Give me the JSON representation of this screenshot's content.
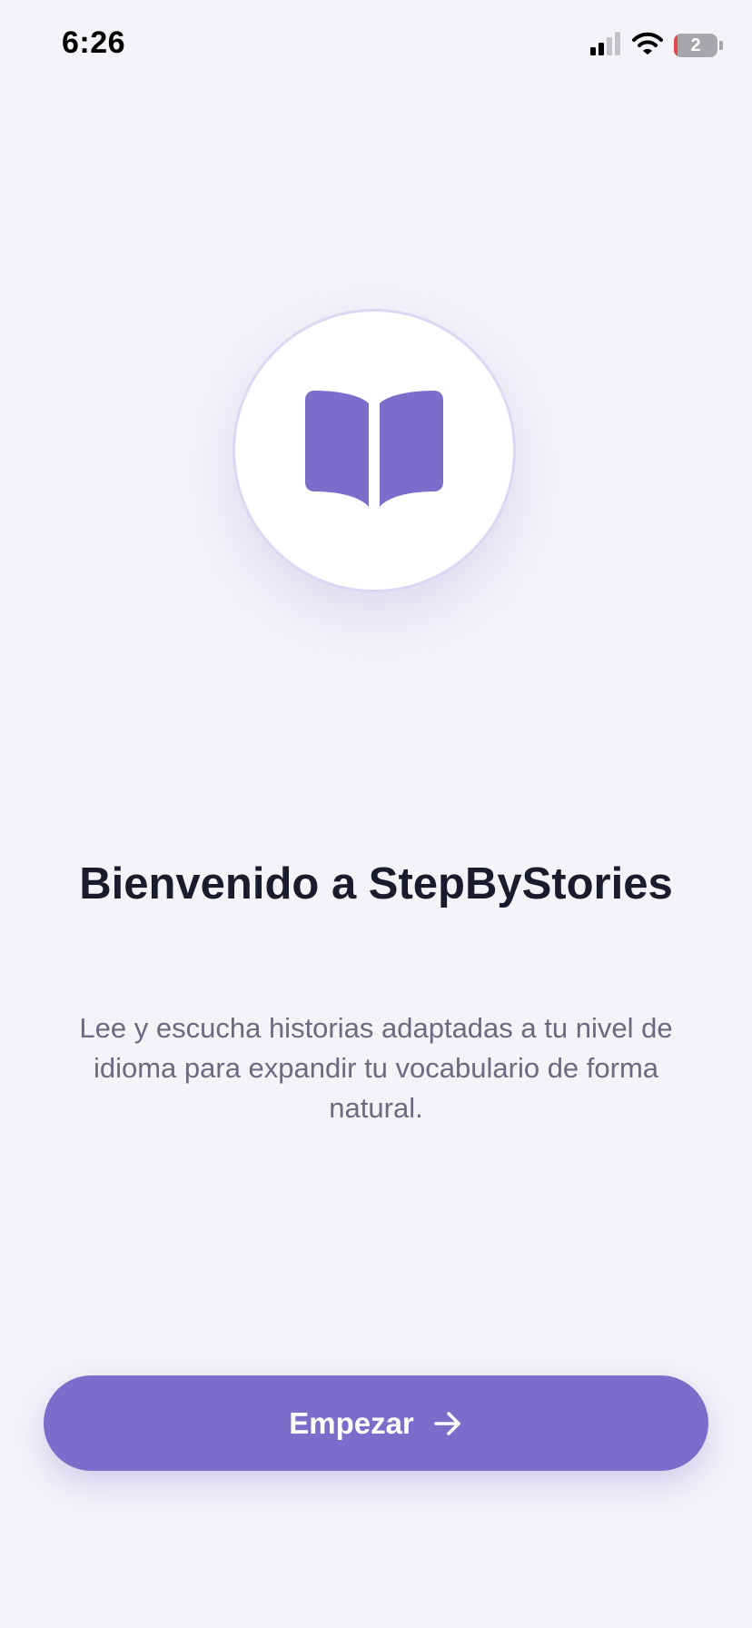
{
  "status_bar": {
    "time": "6:26",
    "battery_text": "2",
    "battery_level_percent": 2,
    "icons": [
      "cellular-signal-icon",
      "wifi-icon",
      "battery-icon"
    ]
  },
  "logo": {
    "icon": "open-book-icon"
  },
  "welcome": {
    "title": "Bienvenido a StepByStories",
    "description": "Lee y escucha historias adaptadas a tu nivel de idioma para expandir tu vocabulario de forma natural."
  },
  "start_button": {
    "label": "Empezar",
    "icon": "arrow-right-icon"
  },
  "colors": {
    "background": "#f3f3f8",
    "accent": "#7b6ecb",
    "title": "#1b1b2e",
    "subtitle": "#6a6a80",
    "battery_low": "#e5484d"
  }
}
